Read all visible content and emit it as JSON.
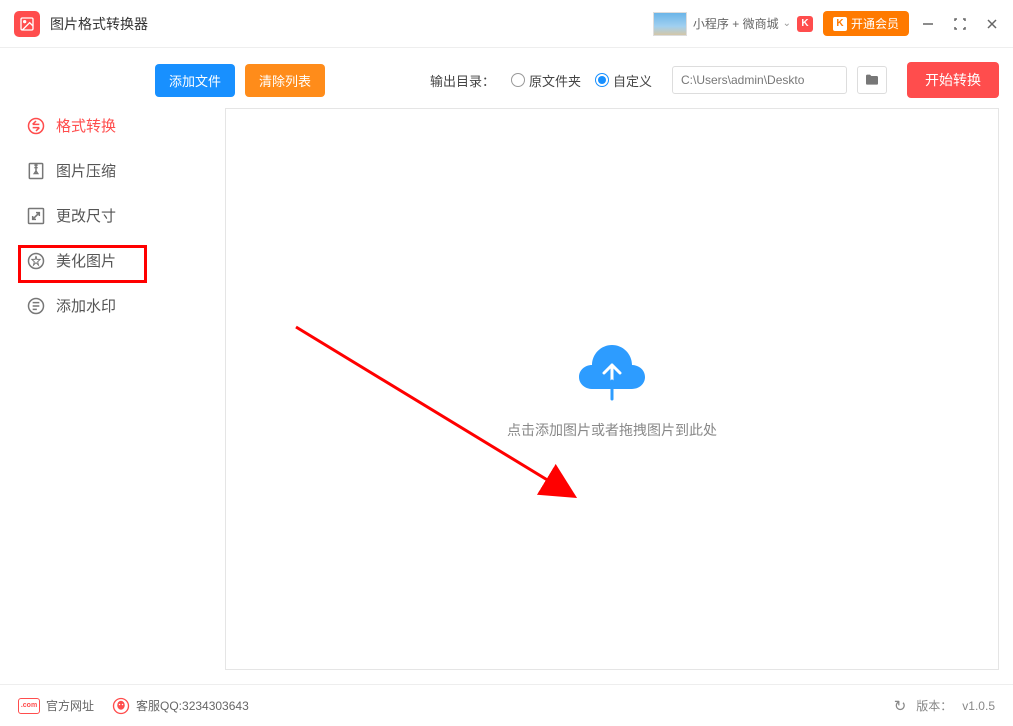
{
  "titlebar": {
    "app_title": "图片格式转换器",
    "promo_text": "小程序 + 微商城",
    "vip_label": "开通会员"
  },
  "sidebar": {
    "items": [
      {
        "label": "格式转换",
        "icon": "convert-icon",
        "active": true
      },
      {
        "label": "图片压缩",
        "icon": "compress-icon",
        "active": false
      },
      {
        "label": "更改尺寸",
        "icon": "resize-icon",
        "active": false
      },
      {
        "label": "美化图片",
        "icon": "beautify-icon",
        "active": false
      },
      {
        "label": "添加水印",
        "icon": "watermark-icon",
        "active": false
      }
    ]
  },
  "toolbar": {
    "add_files": "添加文件",
    "clear_list": "清除列表",
    "output_label": "输出目录：",
    "radio_original": "原文件夹",
    "radio_custom": "自定义",
    "path_value": "C:\\Users\\admin\\Deskto",
    "start_convert": "开始转换"
  },
  "drop": {
    "text": "点击添加图片或者拖拽图片到此处"
  },
  "footer": {
    "official_site": "官方网址",
    "qq_label": "客服QQ:3234303643",
    "version_label": "版本：",
    "version_value": "v1.0.5"
  }
}
